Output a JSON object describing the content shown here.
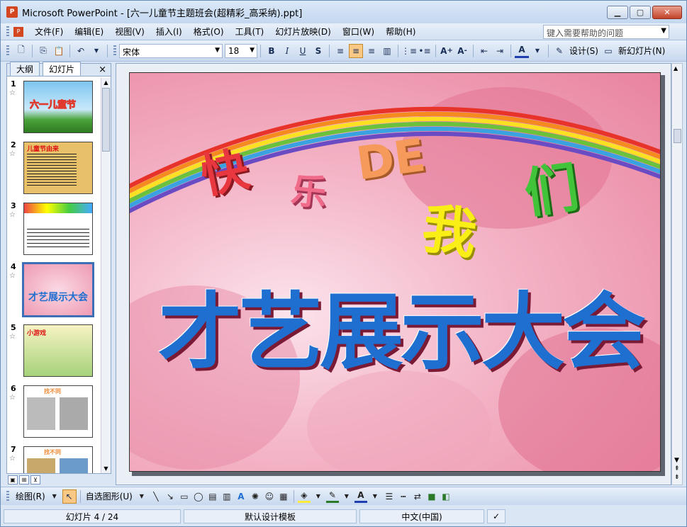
{
  "window": {
    "title": "Microsoft PowerPoint - [六一儿童节主题班会(超精彩_高采纳).ppt]",
    "app_icon": "powerpoint-icon",
    "minimize": "▁",
    "restore": "▢",
    "close": "✕"
  },
  "menubar": {
    "items": [
      "文件(F)",
      "编辑(E)",
      "视图(V)",
      "插入(I)",
      "格式(O)",
      "工具(T)",
      "幻灯片放映(D)",
      "窗口(W)",
      "帮助(H)"
    ],
    "help_placeholder": "键入需要帮助的问题"
  },
  "toolbar": {
    "font_name": "宋体",
    "font_size": "18",
    "bold": "B",
    "italic": "I",
    "underline": "U",
    "shadow": "S",
    "font_color": "A",
    "design_label": "设计(S)",
    "new_slide_label": "新幻灯片(N)"
  },
  "leftpane": {
    "tab_outline": "大纲",
    "tab_slides": "幻灯片",
    "close": "×",
    "slides": [
      {
        "num": "1",
        "text": "六一儿童节"
      },
      {
        "num": "2",
        "text": "儿童节由来"
      },
      {
        "num": "3",
        "text": ""
      },
      {
        "num": "4",
        "text": "才艺展示大会"
      },
      {
        "num": "5",
        "text": "小游戏"
      },
      {
        "num": "6",
        "text": "找不同"
      },
      {
        "num": "7",
        "text": "找不同"
      }
    ],
    "selected": "4"
  },
  "slide": {
    "top_chars": [
      "快",
      "乐",
      "DE",
      "我",
      "们"
    ],
    "main_text": "才艺展示大会"
  },
  "drawbar": {
    "draw_label": "绘图(R)",
    "autoshapes_label": "自选图形(U)"
  },
  "status": {
    "slide_pos": "幻灯片 4 / 24",
    "template": "默认设计模板",
    "language": "中文(中国)"
  },
  "colors": {
    "accent": "#3d6fb6",
    "title_blue": "#1f6fd1",
    "slide_pink": "#f4b6c8"
  }
}
